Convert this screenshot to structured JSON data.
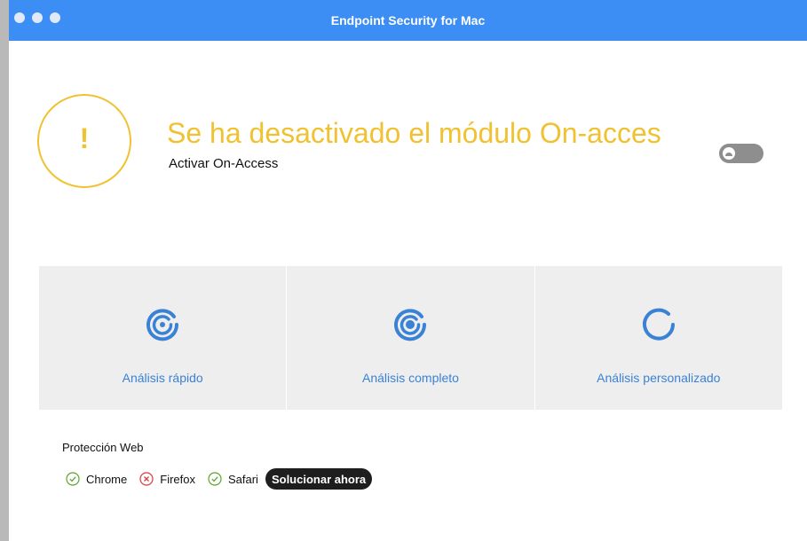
{
  "window": {
    "title": "Endpoint Security for Mac"
  },
  "alert": {
    "title": "Se ha desactivado el módulo On-acces",
    "subtitle": "Activar On-Access",
    "icon": "exclamation-icon",
    "toggle_state": "off",
    "color": "#f0c232"
  },
  "scans": [
    {
      "label": "Análisis rápido",
      "icon": "quick-scan-icon"
    },
    {
      "label": "Análisis completo",
      "icon": "full-scan-icon"
    },
    {
      "label": "Análisis personalizado",
      "icon": "custom-scan-icon"
    }
  ],
  "web_protection": {
    "title": "Protección Web",
    "browsers": [
      {
        "name": "Chrome",
        "status": "ok",
        "icon": "check-circle-icon"
      },
      {
        "name": "Firefox",
        "status": "error",
        "icon": "x-circle-icon"
      },
      {
        "name": "Safari",
        "status": "ok",
        "icon": "check-circle-icon"
      }
    ],
    "fix_label": "Solucionar ahora"
  },
  "colors": {
    "titlebar": "#3c8ef5",
    "accent_blue": "#3a82d6",
    "ok_green": "#5aa62a",
    "error_red": "#d83a3a"
  }
}
